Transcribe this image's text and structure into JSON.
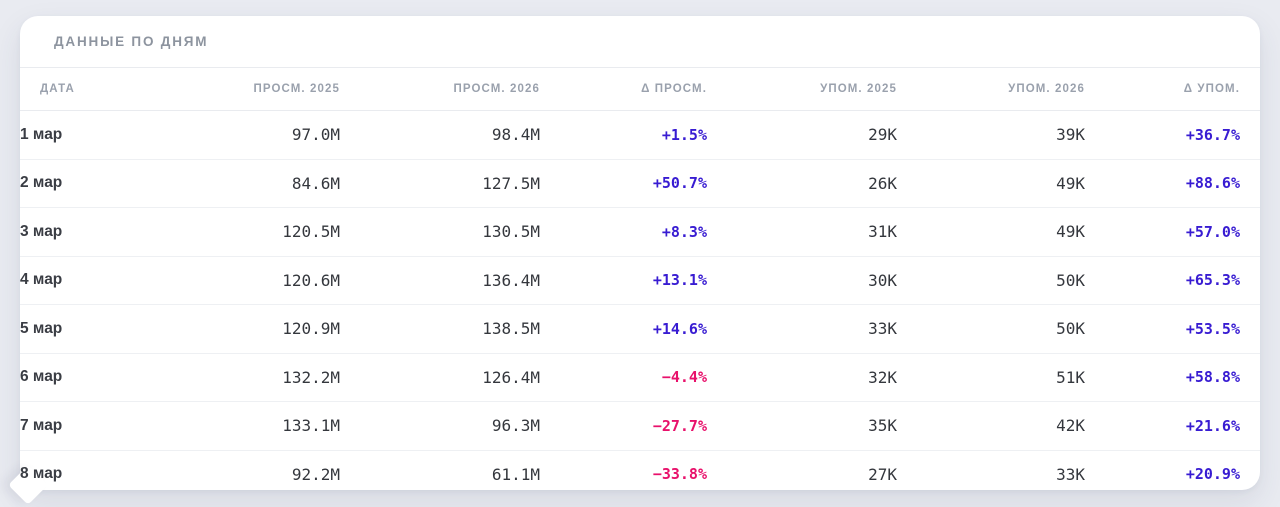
{
  "card": {
    "title": "ДАННЫЕ ПО ДНЯМ"
  },
  "table": {
    "columns": [
      {
        "key": "date",
        "label": "ДАТА",
        "align": "left"
      },
      {
        "key": "views_2025",
        "label": "ПРОСМ. 2025",
        "align": "right"
      },
      {
        "key": "views_2026",
        "label": "ПРОСМ. 2026",
        "align": "right"
      },
      {
        "key": "views_delta",
        "label": "Δ ПРОСМ.",
        "align": "right"
      },
      {
        "key": "mentions_2025",
        "label": "УПОМ. 2025",
        "align": "right"
      },
      {
        "key": "mentions_2026",
        "label": "УПОМ. 2026",
        "align": "right"
      },
      {
        "key": "mentions_delta",
        "label": "Δ УПОМ.",
        "align": "right"
      }
    ],
    "rows": [
      {
        "date": "1 мар",
        "views_2025": "97.0M",
        "views_2026": "98.4M",
        "views_delta": "+1.5%",
        "mentions_2025": "29K",
        "mentions_2026": "39K",
        "mentions_delta": "+36.7%"
      },
      {
        "date": "2 мар",
        "views_2025": "84.6M",
        "views_2026": "127.5M",
        "views_delta": "+50.7%",
        "mentions_2025": "26K",
        "mentions_2026": "49K",
        "mentions_delta": "+88.6%"
      },
      {
        "date": "3 мар",
        "views_2025": "120.5M",
        "views_2026": "130.5M",
        "views_delta": "+8.3%",
        "mentions_2025": "31K",
        "mentions_2026": "49K",
        "mentions_delta": "+57.0%"
      },
      {
        "date": "4 мар",
        "views_2025": "120.6M",
        "views_2026": "136.4M",
        "views_delta": "+13.1%",
        "mentions_2025": "30K",
        "mentions_2026": "50K",
        "mentions_delta": "+65.3%"
      },
      {
        "date": "5 мар",
        "views_2025": "120.9M",
        "views_2026": "138.5M",
        "views_delta": "+14.6%",
        "mentions_2025": "33K",
        "mentions_2026": "50K",
        "mentions_delta": "+53.5%"
      },
      {
        "date": "6 мар",
        "views_2025": "132.2M",
        "views_2026": "126.4M",
        "views_delta": "−4.4%",
        "mentions_2025": "32K",
        "mentions_2026": "51K",
        "mentions_delta": "+58.8%"
      },
      {
        "date": "7 мар",
        "views_2025": "133.1M",
        "views_2026": "96.3M",
        "views_delta": "−27.7%",
        "mentions_2025": "35K",
        "mentions_2026": "42K",
        "mentions_delta": "+21.6%"
      },
      {
        "date": "8 мар",
        "views_2025": "92.2M",
        "views_2026": "61.1M",
        "views_delta": "−33.8%",
        "mentions_2025": "27K",
        "mentions_2026": "33K",
        "mentions_delta": "+20.9%"
      }
    ]
  },
  "colors": {
    "positive_delta": "#381cd2",
    "negative_delta": "#e8116b",
    "page_background": "#e9ebf1",
    "card_background": "#ffffff"
  }
}
